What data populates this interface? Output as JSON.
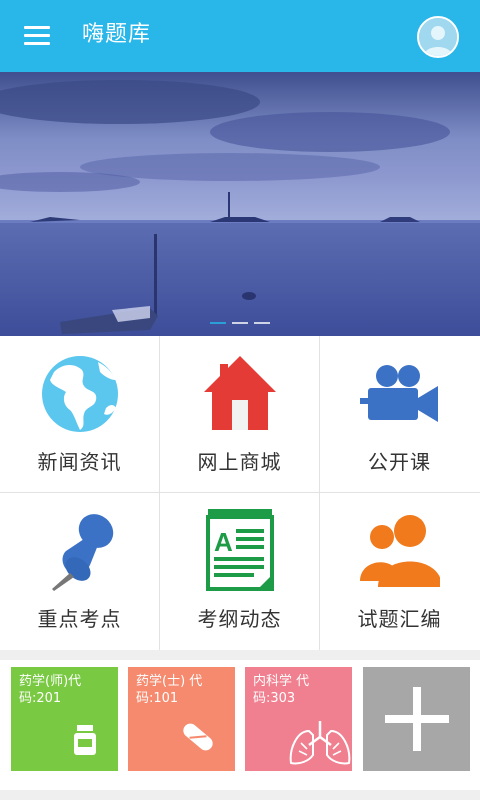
{
  "app": {
    "title": "嗨题库",
    "accent": "#29b6e9"
  },
  "header": {
    "menu_icon": "hamburger-menu-icon",
    "avatar_icon": "user-avatar-icon"
  },
  "banner": {
    "slides": 3,
    "active_slide": 1
  },
  "grid": {
    "items": [
      {
        "label": "新闻资讯",
        "icon": "globe-icon"
      },
      {
        "label": "网上商城",
        "icon": "house-icon"
      },
      {
        "label": "公开课",
        "icon": "video-camera-icon"
      },
      {
        "label": "重点考点",
        "icon": "pushpin-icon"
      },
      {
        "label": "考纲动态",
        "icon": "document-icon"
      },
      {
        "label": "试题汇编",
        "icon": "user-group-icon"
      }
    ]
  },
  "subjects": [
    {
      "name": "药学(师)代",
      "code": "码:201",
      "color": "#7ac943",
      "icon": "medicine-bottle-icon"
    },
    {
      "name": "药学(士) 代",
      "code": "码:101",
      "color": "#f58a6e",
      "icon": "pill-capsule-icon"
    },
    {
      "name": "内科学 代",
      "code": "码:303",
      "color": "#f07f8f",
      "icon": "lungs-icon"
    }
  ],
  "add_tile": {
    "icon": "plus-icon",
    "color": "#a7a7a7"
  }
}
